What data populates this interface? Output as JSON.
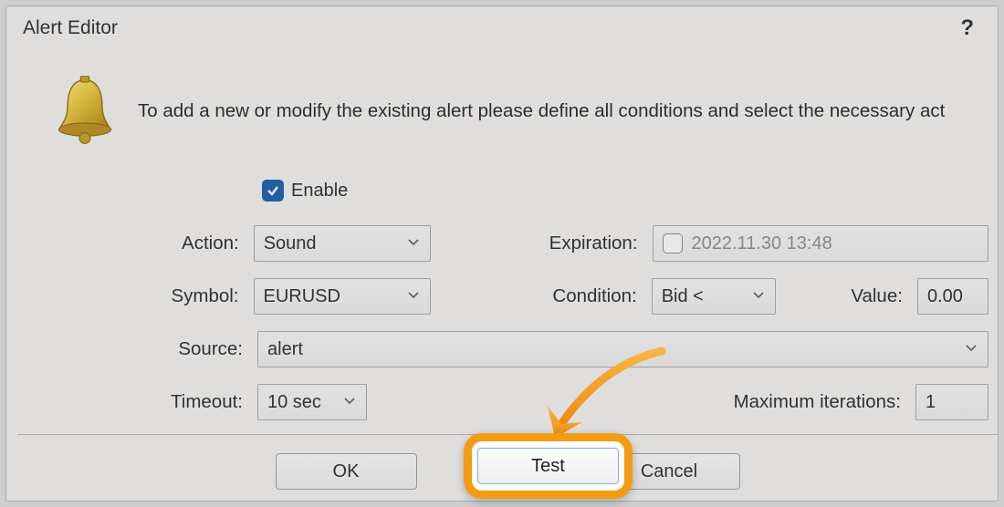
{
  "window": {
    "title": "Alert Editor",
    "help": "?"
  },
  "instruction": "To add a new or modify the existing alert please define all conditions and select the necessary act",
  "form": {
    "enable_label": "Enable",
    "action_label": "Action:",
    "action_value": "Sound",
    "symbol_label": "Symbol:",
    "symbol_value": "EURUSD",
    "source_label": "Source:",
    "source_value": "alert",
    "timeout_label": "Timeout:",
    "timeout_value": "10 sec",
    "expiration_label": "Expiration:",
    "expiration_value": "2022.11.30 13:48",
    "condition_label": "Condition:",
    "condition_value": "Bid <",
    "value_label": "Value:",
    "value_value": "0.00",
    "maxiter_label": "Maximum iterations:",
    "maxiter_value": "1"
  },
  "buttons": {
    "ok": "OK",
    "test": "Test",
    "cancel": "Cancel"
  }
}
